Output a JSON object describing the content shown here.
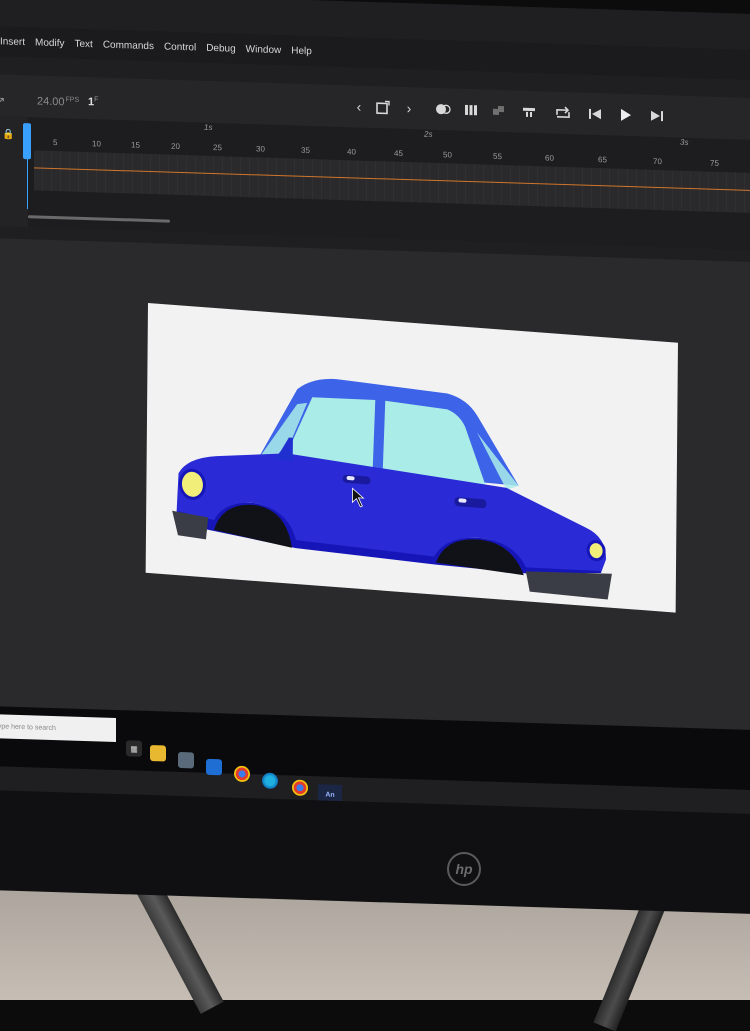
{
  "menubar": {
    "items": [
      "Insert",
      "Modify",
      "Text",
      "Commands",
      "Control",
      "Debug",
      "Window",
      "Help"
    ]
  },
  "timeline": {
    "fps_value": "24.00",
    "fps_unit": "FPS",
    "current_frame": "1",
    "frame_unit": "F",
    "seconds_marks": [
      "1s",
      "2s",
      "3s"
    ],
    "frame_ticks": [
      "5",
      "10",
      "15",
      "20",
      "25",
      "30",
      "35",
      "40",
      "45",
      "50",
      "55",
      "60",
      "65",
      "70",
      "75"
    ]
  },
  "controls": [
    "prev-icon",
    "insert-keyframe-icon",
    "next-icon",
    "onion-skin-icon",
    "edit-multiple-frames-icon",
    "frame-view-icon",
    "center-frame-icon",
    "loop-icon",
    "step-back-icon",
    "play-icon",
    "step-forward-icon"
  ],
  "taskbar": {
    "search_placeholder": "Type here to search",
    "app_label": "An"
  },
  "car": {
    "body_color": "#2a2bd6",
    "body_dark": "#1616b8",
    "roof_color": "#3d63e8",
    "window_color": "#a9ece8",
    "light_color": "#f2ee7a",
    "bumper_color": "#3a3d45"
  },
  "monitor": {
    "brand": "hp"
  }
}
